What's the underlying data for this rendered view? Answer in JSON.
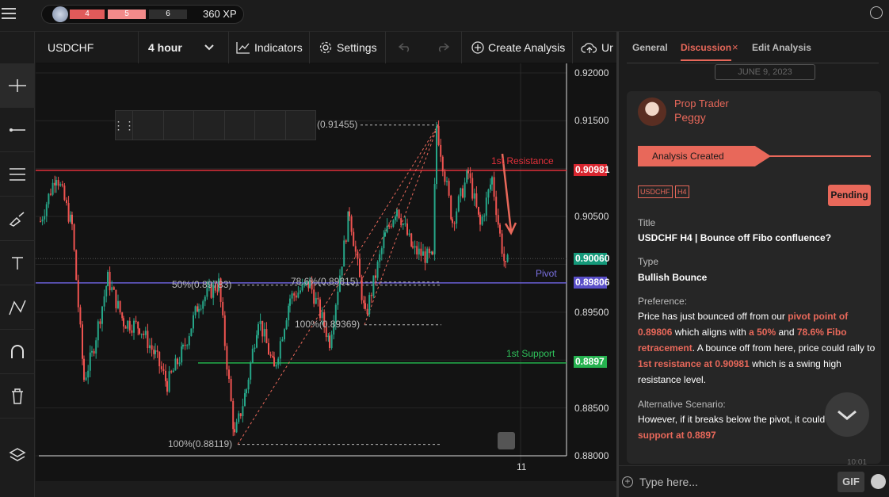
{
  "topbar": {
    "levels": [
      "4",
      "5",
      "6"
    ],
    "xp": "360 XP"
  },
  "toolbar": {
    "symbol": "USDCHF",
    "timeframe": "4 hour",
    "indicators": "Indicators",
    "settings": "Settings",
    "create": "Create Analysis",
    "upload": "Ur"
  },
  "chart": {
    "price_ticks": [
      "0.92000",
      "0.91500",
      "0.91000",
      "0.90500",
      "0.90000",
      "0.89500",
      "0.89000",
      "0.88500",
      "0.88000"
    ],
    "x_tick": "11",
    "resistance": {
      "label": "1st Resistance",
      "tag": "0.90981",
      "color": "#e0303a"
    },
    "support": {
      "label": "1st Support",
      "tag": "0.8897",
      "color": "#22b14c"
    },
    "pivot": {
      "label": "Pivot",
      "tag": "0.89806",
      "color": "#6a5fd6"
    },
    "current": {
      "tag": "0.90060",
      "color": "#1aa37a"
    },
    "fib_labels": {
      "top": "(0.91455)",
      "f50": "50%(0.89783)",
      "f786": "78.6%(0.89815)",
      "f100a": "100%(0.89369)",
      "f100b": "100%(0.88119)"
    }
  },
  "panel": {
    "tabs": [
      "General",
      "Discussion",
      "Edit Analysis"
    ],
    "date": "JUNE 9, 2023",
    "author_role": "Prop Trader",
    "author_name": "Peggy",
    "banner": "Analysis Created",
    "chips": [
      "USDCHF",
      "H4"
    ],
    "status": "Pending",
    "title_label": "Title",
    "title": "USDCHF H4 | Bounce off Fibo confluence?",
    "type_label": "Type",
    "type": "Bullish Bounce",
    "pref_label": "Preference:",
    "pref": {
      "a": "Price has just bounced off from our ",
      "b": "pivot point of 0.89806",
      "c": " which aligns with ",
      "d": "a 50%",
      "e": " and ",
      "f": "78.6% Fibo retracement",
      "g": ". A bounce off from here, price could rally to ",
      "h": "1st resistance at 0.90981",
      "i": " which is a swing high resistance level."
    },
    "alt_label": "Alternative Scenario:",
    "alt": {
      "a": "However, if it breaks below the pivot, it could",
      "b": "support at 0.8897"
    },
    "time_partial": "10:01",
    "input_placeholder": "Type here...",
    "gif": "GIF"
  },
  "colors": {
    "accent": "#e8685a",
    "up": "#26a688",
    "down": "#ef5350"
  }
}
